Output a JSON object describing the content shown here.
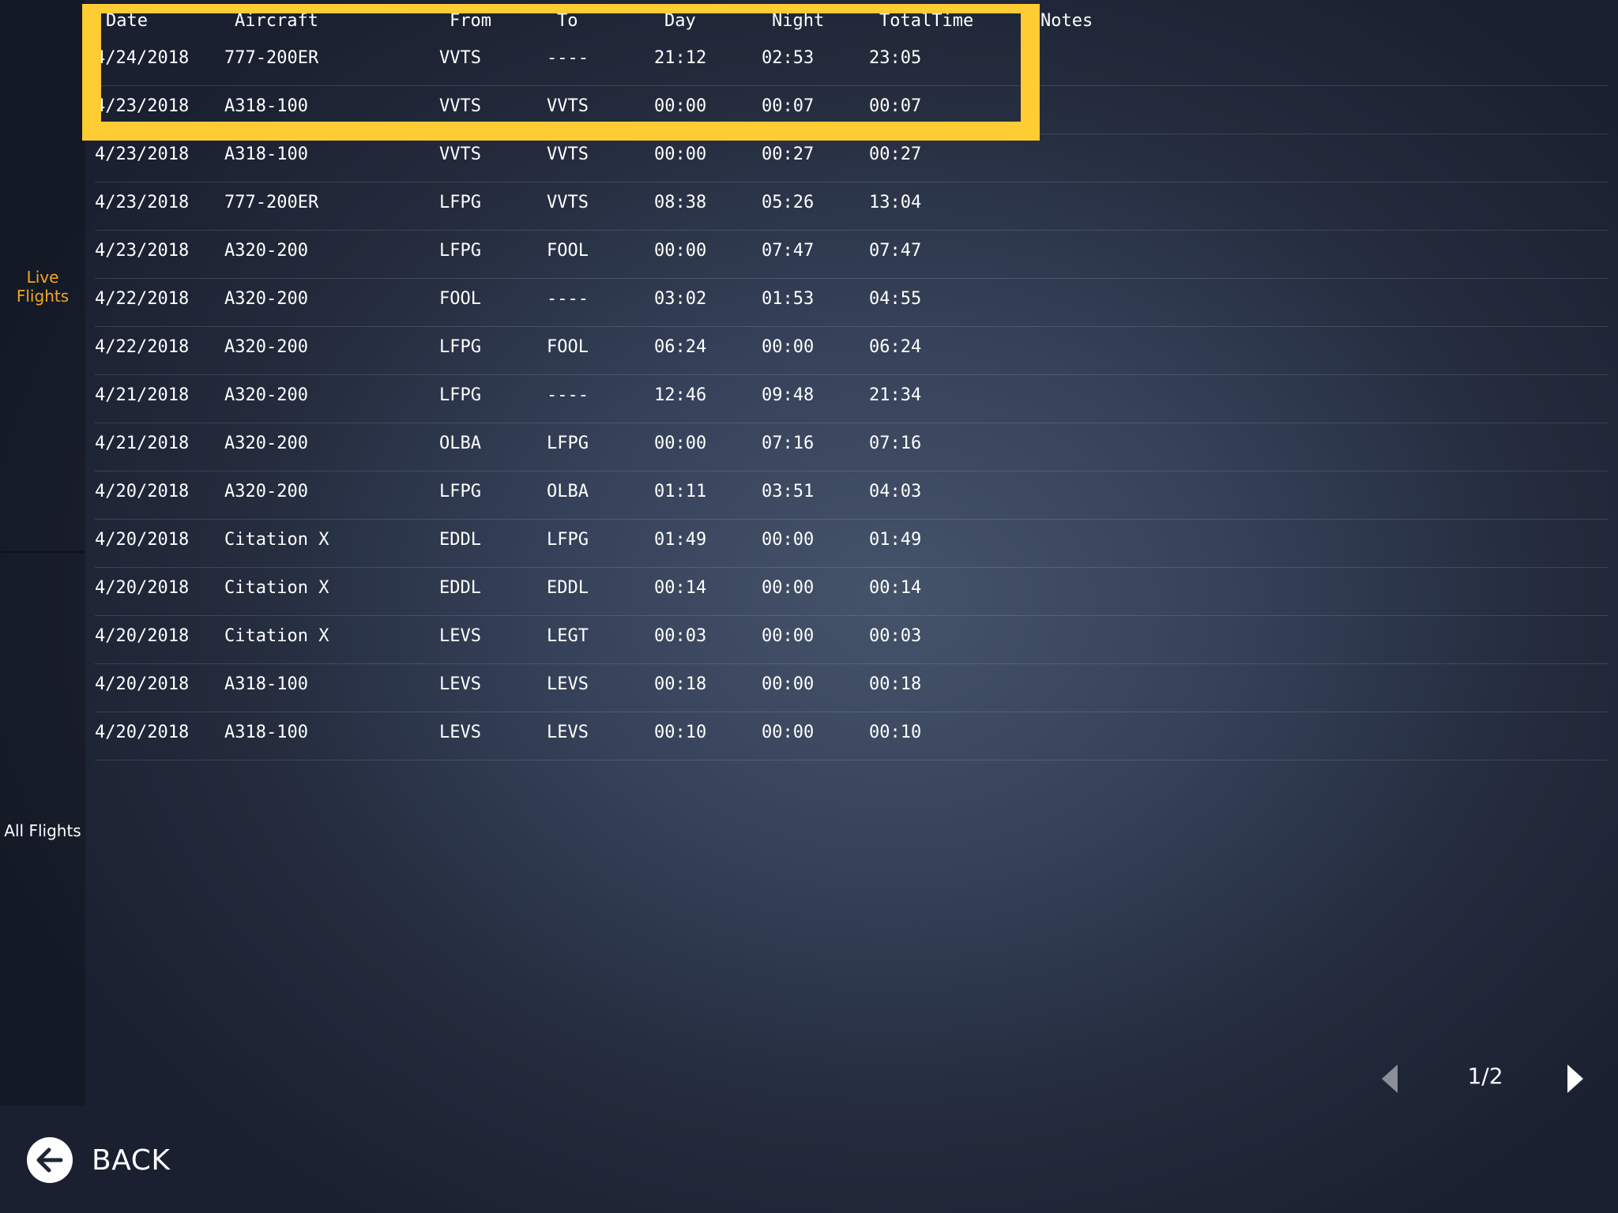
{
  "sidebar": {
    "items": [
      {
        "label": "Live Flights",
        "active": true
      },
      {
        "label": "All Flights",
        "active": false
      }
    ]
  },
  "table": {
    "headers": {
      "date": "Date",
      "aircraft": "Aircraft",
      "from": "From",
      "to": "To",
      "day": "Day",
      "night": "Night",
      "total": "TotalTime",
      "notes": "Notes"
    },
    "rows": [
      {
        "date": "4/24/2018",
        "aircraft": "777-200ER",
        "from": "VVTS",
        "to": "----",
        "day": "21:12",
        "night": "02:53",
        "total": "23:05"
      },
      {
        "date": "4/23/2018",
        "aircraft": "A318-100",
        "from": "VVTS",
        "to": "VVTS",
        "day": "00:00",
        "night": "00:07",
        "total": "00:07"
      },
      {
        "date": "4/23/2018",
        "aircraft": "A318-100",
        "from": "VVTS",
        "to": "VVTS",
        "day": "00:00",
        "night": "00:27",
        "total": "00:27"
      },
      {
        "date": "4/23/2018",
        "aircraft": "777-200ER",
        "from": "LFPG",
        "to": "VVTS",
        "day": "08:38",
        "night": "05:26",
        "total": "13:04"
      },
      {
        "date": "4/23/2018",
        "aircraft": "A320-200",
        "from": "LFPG",
        "to": "FOOL",
        "day": "00:00",
        "night": "07:47",
        "total": "07:47"
      },
      {
        "date": "4/22/2018",
        "aircraft": "A320-200",
        "from": "FOOL",
        "to": "----",
        "day": "03:02",
        "night": "01:53",
        "total": "04:55"
      },
      {
        "date": "4/22/2018",
        "aircraft": "A320-200",
        "from": "LFPG",
        "to": "FOOL",
        "day": "06:24",
        "night": "00:00",
        "total": "06:24"
      },
      {
        "date": "4/21/2018",
        "aircraft": "A320-200",
        "from": "LFPG",
        "to": "----",
        "day": "12:46",
        "night": "09:48",
        "total": "21:34"
      },
      {
        "date": "4/21/2018",
        "aircraft": "A320-200",
        "from": "OLBA",
        "to": "LFPG",
        "day": "00:00",
        "night": "07:16",
        "total": "07:16"
      },
      {
        "date": "4/20/2018",
        "aircraft": "A320-200",
        "from": "LFPG",
        "to": "OLBA",
        "day": "01:11",
        "night": "03:51",
        "total": "04:03"
      },
      {
        "date": "4/20/2018",
        "aircraft": "Citation X",
        "from": "EDDL",
        "to": "LFPG",
        "day": "01:49",
        "night": "00:00",
        "total": "01:49"
      },
      {
        "date": "4/20/2018",
        "aircraft": "Citation X",
        "from": "EDDL",
        "to": "EDDL",
        "day": "00:14",
        "night": "00:00",
        "total": "00:14"
      },
      {
        "date": "4/20/2018",
        "aircraft": "Citation X",
        "from": "LEVS",
        "to": "LEGT",
        "day": "00:03",
        "night": "00:00",
        "total": "00:03"
      },
      {
        "date": "4/20/2018",
        "aircraft": "A318-100",
        "from": "LEVS",
        "to": "LEVS",
        "day": "00:18",
        "night": "00:00",
        "total": "00:18"
      },
      {
        "date": "4/20/2018",
        "aircraft": "A318-100",
        "from": "LEVS",
        "to": "LEVS",
        "day": "00:10",
        "night": "00:00",
        "total": "00:10"
      }
    ]
  },
  "pagination": {
    "page_label": "1/2",
    "prev_icon": "chevron-left-icon",
    "next_icon": "chevron-right-icon"
  },
  "back": {
    "label": "BACK",
    "icon": "arrow-left-circle-icon"
  },
  "colors": {
    "active_nav": "#f5a623",
    "highlight": "#ffcc33",
    "text": "#ffffff"
  }
}
